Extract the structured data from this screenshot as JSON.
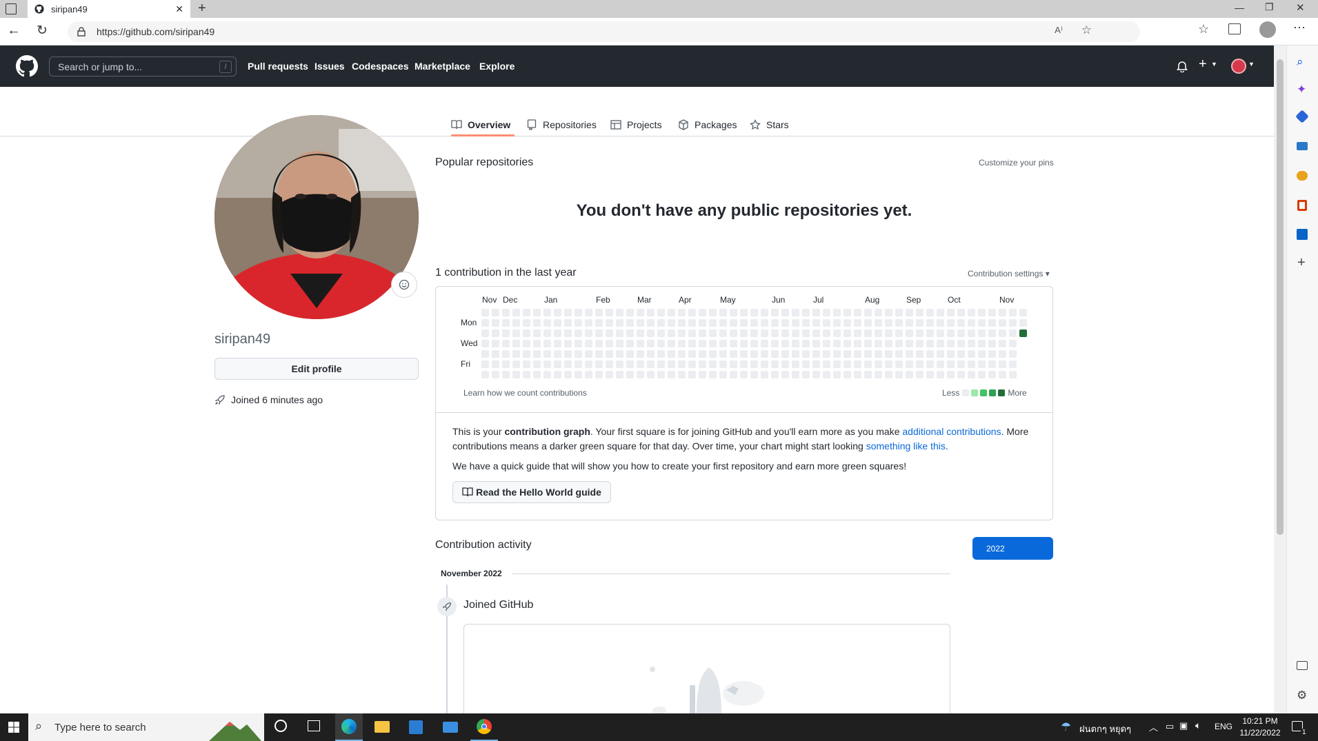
{
  "browser": {
    "tab_title": "siripan49",
    "url": "https://github.com/siripan49",
    "new_tab": "+",
    "window_controls": [
      "minimize-icon",
      "restore-icon",
      "close-icon"
    ]
  },
  "github": {
    "search_placeholder": "Search or jump to...",
    "search_key": "/",
    "nav": [
      "Pull requests",
      "Issues",
      "Codespaces",
      "Marketplace",
      "Explore"
    ],
    "tabs": [
      "Overview",
      "Repositories",
      "Projects",
      "Packages",
      "Stars"
    ],
    "active_tab": "Overview"
  },
  "profile": {
    "username": "siripan49",
    "edit_label": "Edit profile",
    "joined": "Joined 6 minutes ago"
  },
  "popular": {
    "title": "Popular repositories",
    "customize": "Customize your pins",
    "empty": "You don't have any public repositories yet."
  },
  "contrib": {
    "title": "1 contribution in the last year",
    "settings": "Contribution settings ▾",
    "months": [
      "Nov",
      "Dec",
      "Jan",
      "Feb",
      "Mar",
      "Apr",
      "May",
      "Jun",
      "Jul",
      "Aug",
      "Sep",
      "Oct",
      "Nov"
    ],
    "days": [
      "Mon",
      "Wed",
      "Fri"
    ],
    "learn": "Learn how we count contributions",
    "less": "Less",
    "more": "More",
    "info_p1_a": "This is your ",
    "info_p1_b": "contribution graph",
    "info_p1_c": ". Your first square is for joining GitHub and you'll earn more as you make ",
    "info_p1_link1": "additional contributions",
    "info_p1_d": ". More contributions means a darker green square for that day. Over time, your chart might start looking ",
    "info_p1_link2": "something like this",
    "info_p1_e": ".",
    "info_p2": "We have a quick guide that will show you how to create your first repository and earn more green squares!",
    "guide_btn": "Read the Hello World guide"
  },
  "activity": {
    "title": "Contribution activity",
    "year": "2022",
    "month": "November 2022",
    "event": "Joined GitHub"
  },
  "taskbar": {
    "search_placeholder": "Type here to search",
    "weather": "ฝนตกๆ หยุดๆ",
    "lang": "ENG",
    "time": "10:21 PM",
    "date": "11/22/2022",
    "notif_count": "1"
  },
  "colors": {
    "header_bg": "#24292f",
    "accent": "#0969da",
    "tab_underline": "#fd8c73",
    "contrib_empty": "#ebedf0",
    "contrib_l1": "#9be9a8",
    "contrib_l2": "#40c463",
    "contrib_l3": "#30a14e",
    "contrib_l4": "#216e39"
  }
}
